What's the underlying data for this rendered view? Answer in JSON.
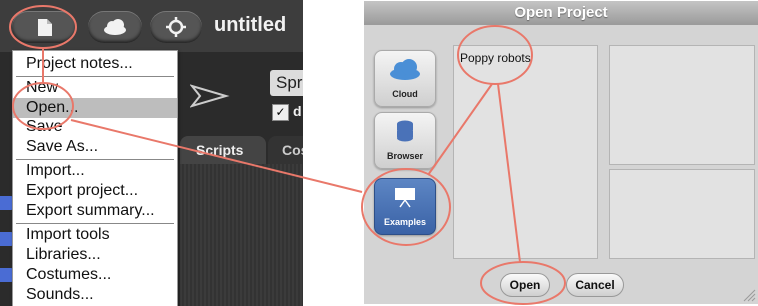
{
  "ide": {
    "project_title": "untitled",
    "sprite_name": "Sprit",
    "draggable_label": "d",
    "tabs": {
      "scripts": "Scripts",
      "costumes": "Cost"
    },
    "file_menu": {
      "items": [
        "Project notes...",
        "New",
        "Open...",
        "Save",
        "Save As...",
        "Import...",
        "Export project...",
        "Export summary...",
        "Import tools",
        "Libraries...",
        "Costumes...",
        "Sounds..."
      ],
      "highlighted": "Open..."
    }
  },
  "dialog": {
    "title": "Open Project",
    "sources": [
      "Cloud",
      "Browser",
      "Examples"
    ],
    "active_source": "Examples",
    "projects": [
      "Poppy robots"
    ],
    "buttons": {
      "open": "Open",
      "cancel": "Cancel"
    }
  },
  "colors": {
    "annotation": "#e9786a",
    "ide_bg": "#2a2a2a",
    "menu_highlight": "#bdbdbd",
    "active_source": "#4a72b8"
  },
  "icons": [
    "file-icon",
    "cloud-icon",
    "gear-icon",
    "sprite-arrow-icon",
    "cloud-icon",
    "database-icon",
    "presentation-icon"
  ]
}
